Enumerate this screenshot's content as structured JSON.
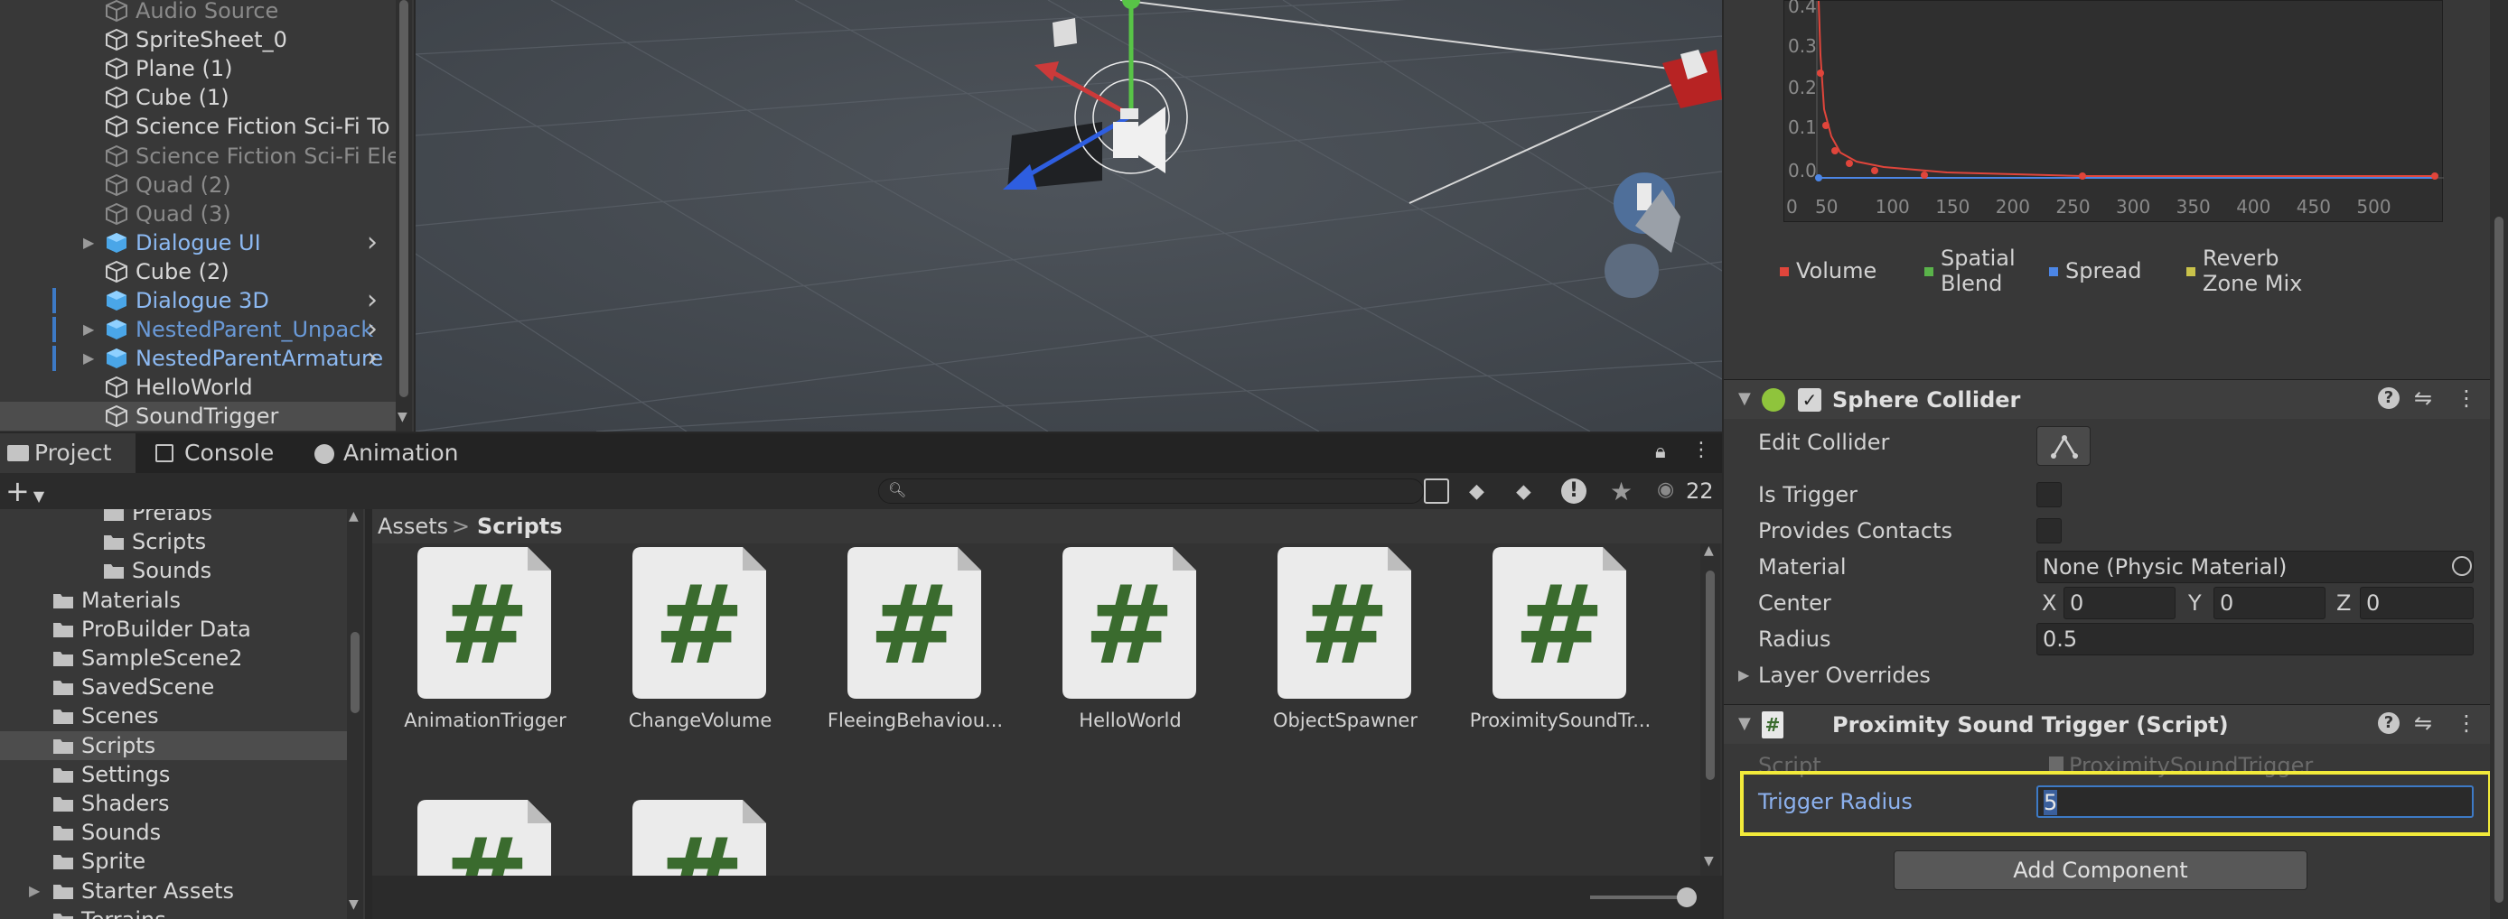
{
  "hierarchy": {
    "items": [
      {
        "label": "Audio Source",
        "dim": true
      },
      {
        "label": "SpriteSheet_0",
        "dim": false
      },
      {
        "label": "Plane (1)",
        "dim": false
      },
      {
        "label": "Cube (1)",
        "dim": false
      },
      {
        "label": "Science Fiction Sci-Fi To",
        "dim": false
      },
      {
        "label": "Science Fiction Sci-Fi Ele",
        "dim": true
      },
      {
        "label": "Quad (2)",
        "dim": true
      },
      {
        "label": "Quad (3)",
        "dim": true
      },
      {
        "label": "Dialogue UI",
        "prefab": true
      },
      {
        "label": "Cube (2)",
        "dim": false
      },
      {
        "label": "Dialogue 3D",
        "prefab": true
      },
      {
        "label": "NestedParent_Unpack",
        "prefab": true
      },
      {
        "label": "NestedParentArmature",
        "prefab": true
      },
      {
        "label": "HelloWorld",
        "dim": false
      },
      {
        "label": "SoundTrigger",
        "dim": false
      }
    ]
  },
  "tabs": {
    "project": "Project",
    "console": "Console",
    "animation": "Animation"
  },
  "toolbar": {
    "add": "+",
    "search_placeholder": "",
    "visible_count": "22"
  },
  "breadcrumb": {
    "root": "Assets",
    "separator": ">",
    "current": "Scripts"
  },
  "project_tree": {
    "items": [
      {
        "label": "Prefabs"
      },
      {
        "label": "Scripts"
      },
      {
        "label": "Sounds"
      },
      {
        "label": "Materials"
      },
      {
        "label": "ProBuilder Data"
      },
      {
        "label": "SampleScene2"
      },
      {
        "label": "SavedScene"
      },
      {
        "label": "Scenes"
      },
      {
        "label": "Scripts"
      },
      {
        "label": "Settings"
      },
      {
        "label": "Shaders"
      },
      {
        "label": "Sounds"
      },
      {
        "label": "Sprite"
      },
      {
        "label": "Starter Assets"
      },
      {
        "label": "Terrains"
      }
    ]
  },
  "assets": [
    {
      "label": "AnimationTrigger"
    },
    {
      "label": "ChangeVolume"
    },
    {
      "label": "FleeingBehaviou..."
    },
    {
      "label": "HelloWorld"
    },
    {
      "label": "ObjectSpawner"
    },
    {
      "label": "ProximitySoundTr..."
    }
  ],
  "inspector": {
    "graph": {
      "y_ticks": [
        "0.4",
        "0.3",
        "0.2",
        "0.1",
        "0.0"
      ],
      "x_ticks": [
        "0",
        "50",
        "100",
        "150",
        "200",
        "250",
        "300",
        "350",
        "400",
        "450",
        "500"
      ],
      "legend": [
        {
          "label": "Volume",
          "color": "#e0453b"
        },
        {
          "label": "Spatial Blend",
          "color": "#5ab34a"
        },
        {
          "label": "Spread",
          "color": "#4c86e6"
        },
        {
          "label": "Reverb Zone Mix",
          "color": "#c9c24a"
        }
      ]
    },
    "sphere_collider": {
      "title": "Sphere Collider",
      "edit_collider": "Edit Collider",
      "is_trigger": "Is Trigger",
      "provides_contacts": "Provides Contacts",
      "material_label": "Material",
      "material_value": "None (Physic Material)",
      "center_label": "Center",
      "center_x_label": "X",
      "center_x": "0",
      "center_y_label": "Y",
      "center_y": "0",
      "center_z_label": "Z",
      "center_z": "0",
      "radius_label": "Radius",
      "radius_value": "0.5",
      "layer_overrides": "Layer Overrides"
    },
    "script": {
      "title": "Proximity Sound Trigger (Script)",
      "script_label": "Script",
      "script_value": "ProximitySoundTrigger",
      "trigger_radius_label": "Trigger Radius",
      "trigger_radius_value": "5",
      "highlight_color": "#f2ea3a"
    },
    "add_component": "Add Component"
  }
}
